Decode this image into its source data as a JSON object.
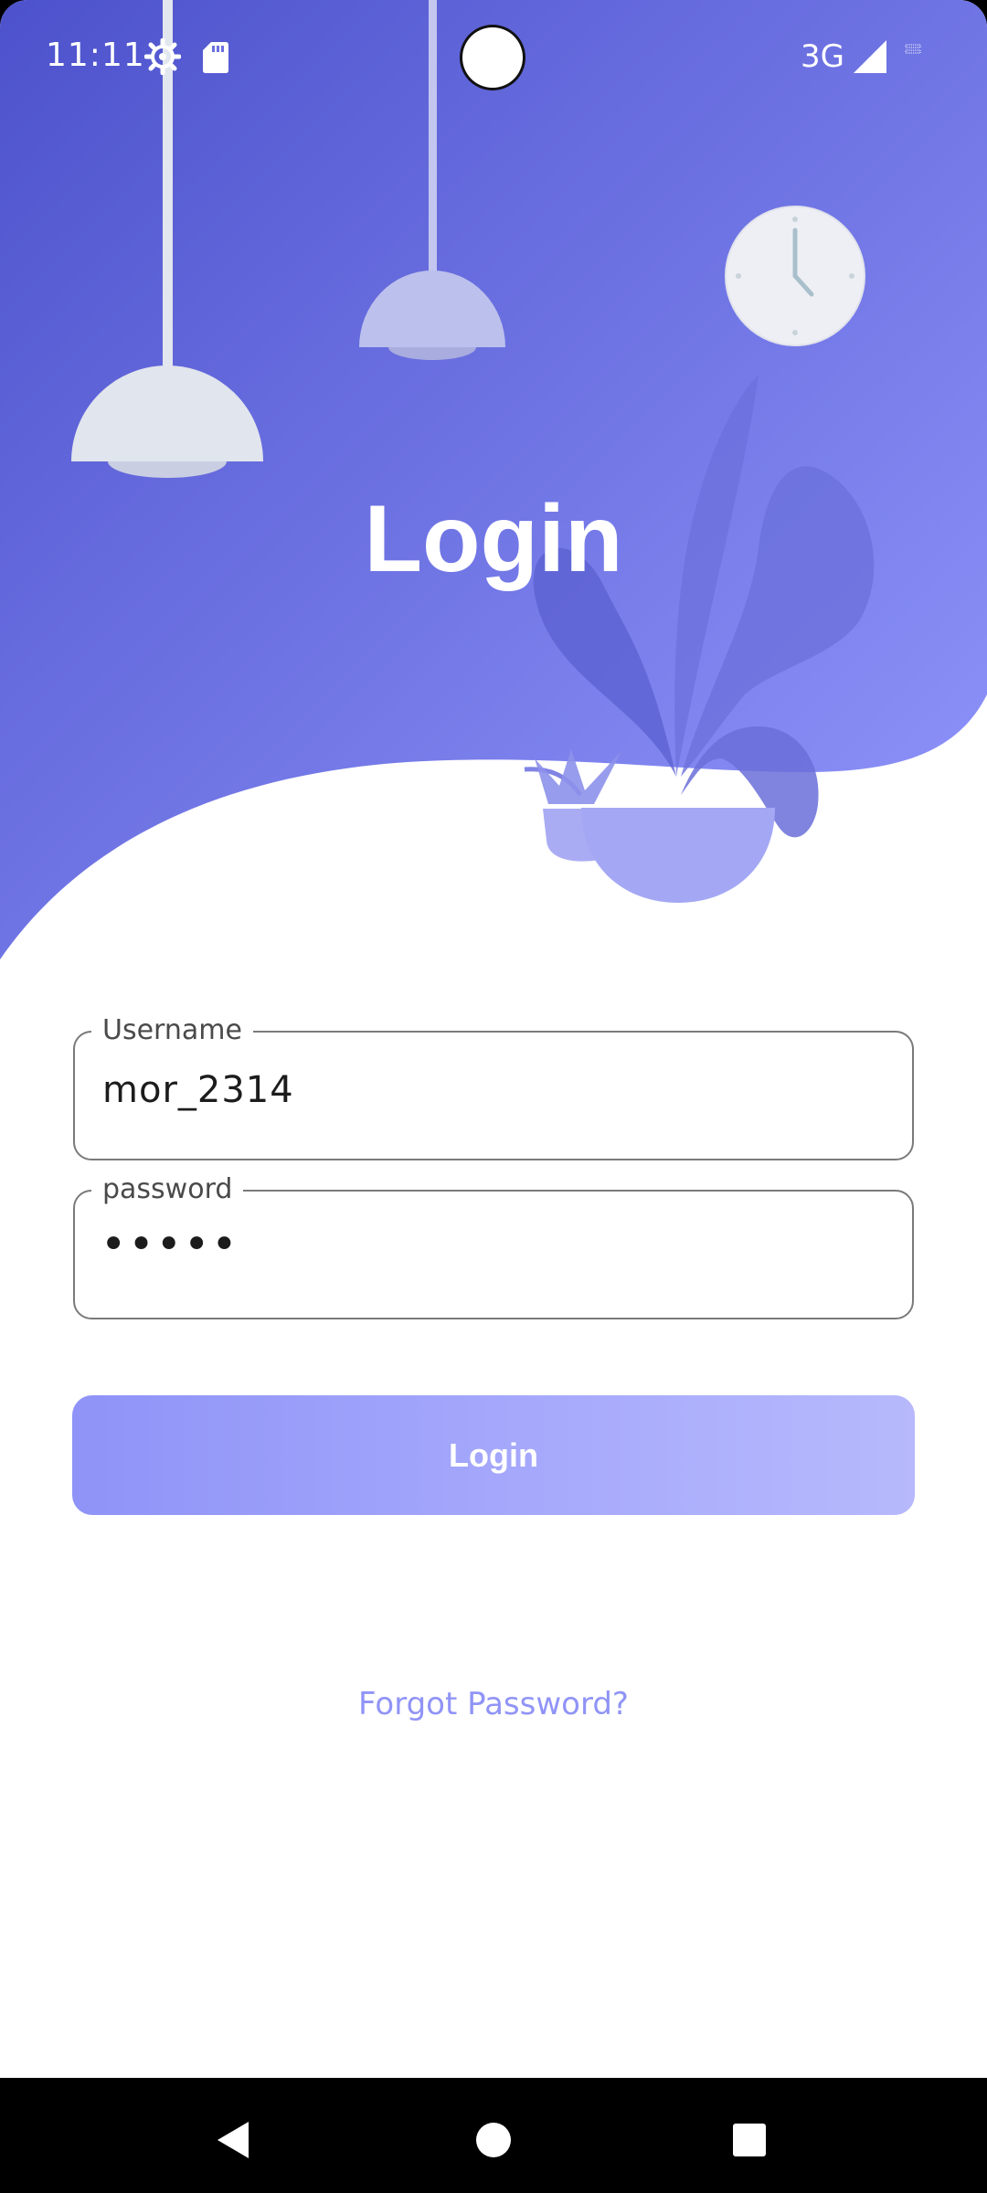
{
  "status_bar": {
    "time": "11:11",
    "network": "3G",
    "icons": [
      "gear-icon",
      "sd-card-icon",
      "signal-icon",
      "battery-icon"
    ]
  },
  "login_screen": {
    "title": "Login",
    "username": {
      "label": "Username",
      "value": "mor_2314"
    },
    "password": {
      "label": "password",
      "masked_value": "•••••"
    },
    "login_button": "Login",
    "forgot_password": "Forgot Password?"
  },
  "colors": {
    "hero_gradient_start": "#5156d2",
    "hero_gradient_end": "#8e93fa",
    "button_gradient_start": "#8f93f7",
    "button_gradient_end": "#b7b9fc",
    "link": "#9094f6"
  },
  "navigation_bar": {
    "buttons": [
      "back-icon",
      "home-icon",
      "recents-icon"
    ]
  }
}
